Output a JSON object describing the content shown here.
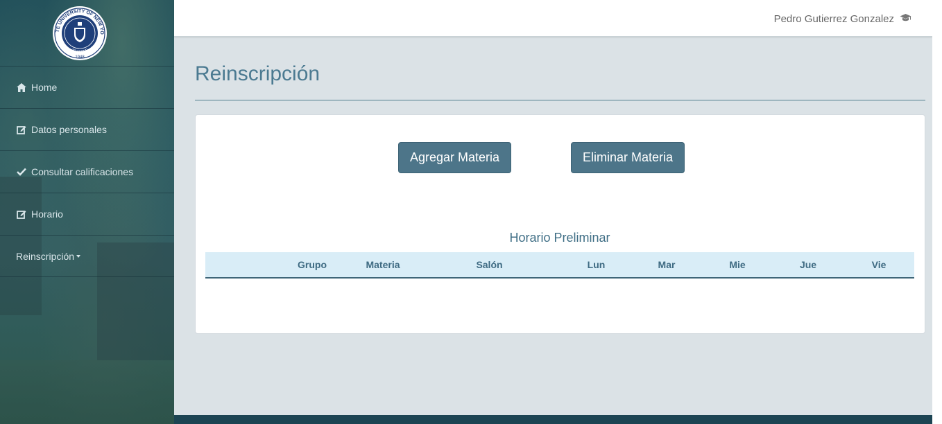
{
  "brand": {
    "seal_text_top": "STATE UNIVERSITY OF NEW YORK",
    "seal_text_bottom": "TO SERVE",
    "seal_year": "1948"
  },
  "sidebar": {
    "items": [
      {
        "label": "Home",
        "icon": "home-icon"
      },
      {
        "label": "Datos personales",
        "icon": "edit-icon"
      },
      {
        "label": "Consultar calificaciones",
        "icon": "check-icon"
      },
      {
        "label": "Horario",
        "icon": "edit-icon"
      },
      {
        "label": "Reinscripción",
        "icon": "caret-down-icon"
      }
    ]
  },
  "header": {
    "user_name": "Pedro Gutierrez Gonzalez",
    "user_icon": "graduation-cap-icon"
  },
  "main": {
    "title": "Reinscripción",
    "add_button": "Agregar Materia",
    "remove_button": "Eliminar Materia",
    "table_title": "Horario Preliminar",
    "columns": [
      "",
      "Grupo",
      "Materia",
      "Salón",
      "",
      "Lun",
      "Mar",
      "Mie",
      "Jue",
      "Vie"
    ]
  },
  "colors": {
    "accent": "#4d7589",
    "title": "#4b7a91",
    "table_header_bg": "#d9edf7",
    "footer": "#1c4453"
  }
}
